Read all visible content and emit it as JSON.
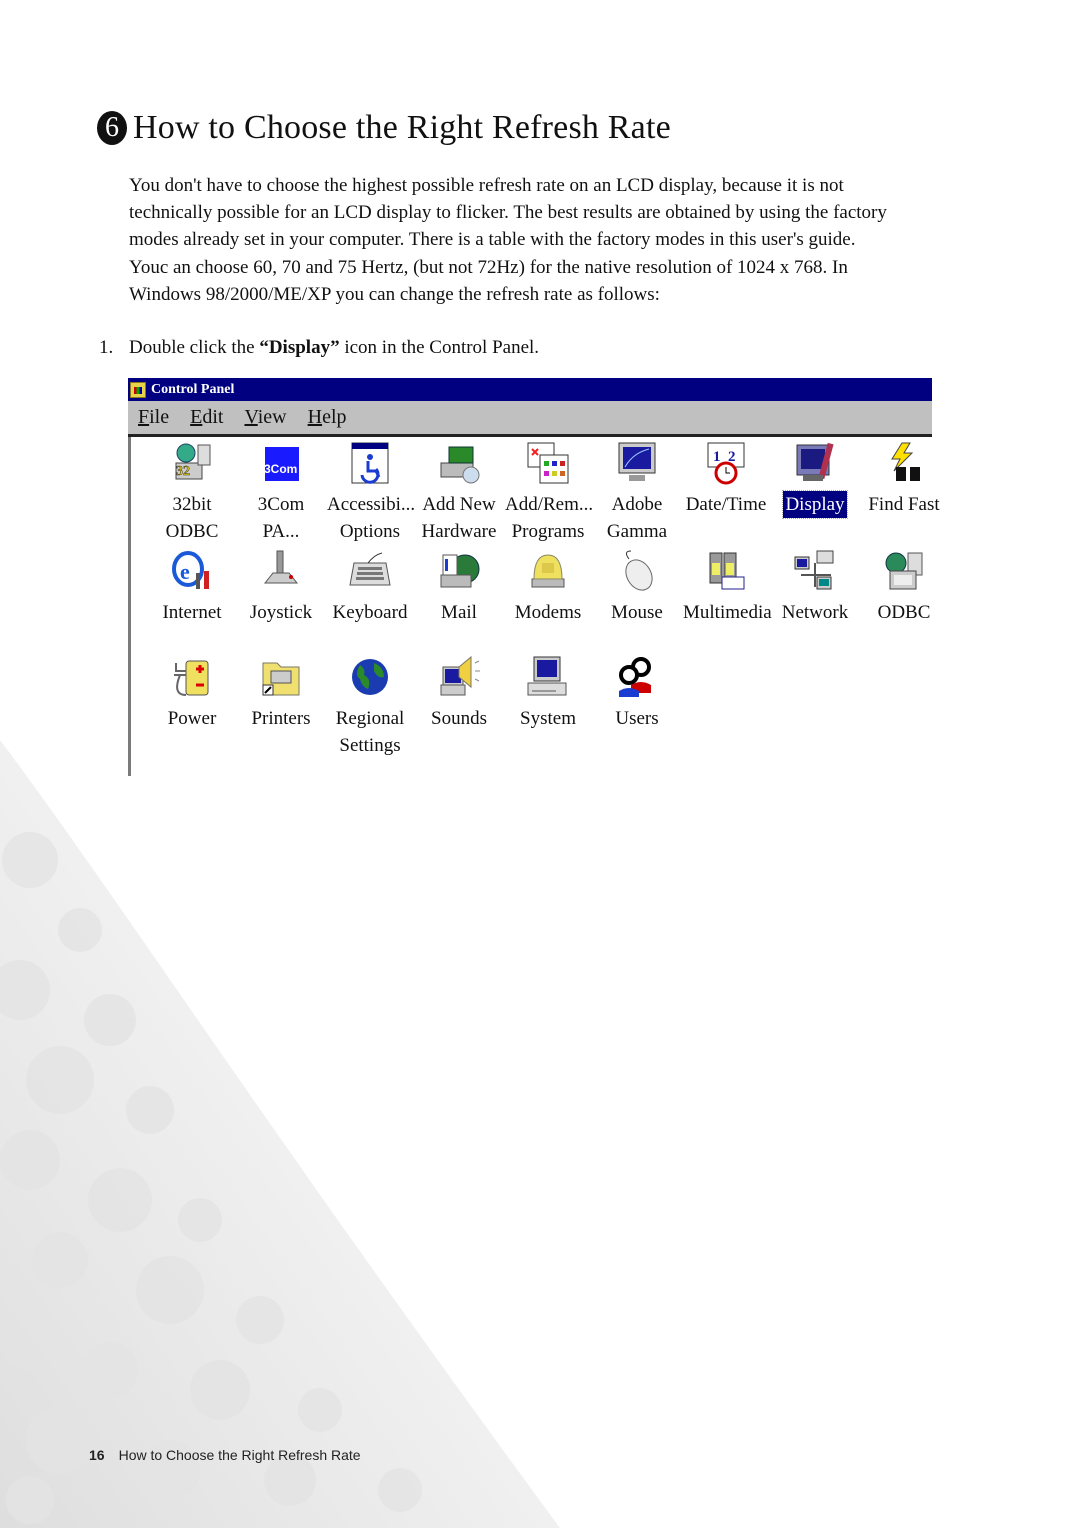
{
  "heading": {
    "number": "6",
    "title": "How to Choose the Right Refresh Rate"
  },
  "intro_lines": [
    "You don't  have to choose the highest possible refresh rate on an LCD display, because it is not",
    "technically possible for an LCD display to flicker. The best results are obtained by using the factory",
    "modes already set in your computer. There is a table with the factory modes in this user's guide.",
    "Youc an choose 60, 70 and 75 Hertz, (but not 72Hz) for the native resolution of 1024 x 768. In",
    "Windows 98/2000/ME/XP you can change the refresh rate as follows:"
  ],
  "steps": [
    {
      "number": "1.",
      "before": "Double click the ",
      "bold": "“Display”",
      "after": " icon in the Control Panel."
    }
  ],
  "control_panel": {
    "title": "Control Panel",
    "title_icon": "control-panel-icon",
    "menu": [
      {
        "mnemonic": "F",
        "rest": "ile"
      },
      {
        "mnemonic": "E",
        "rest": "dit"
      },
      {
        "mnemonic": "V",
        "rest": "iew"
      },
      {
        "mnemonic": "H",
        "rest": "elp"
      }
    ],
    "colors": {
      "titlebar": "#000080",
      "menubar": "#c0c0c0",
      "selection": "#000080"
    },
    "items": [
      {
        "line1": "32bit",
        "line2": "ODBC",
        "icon": "odbc-32bit-icon",
        "selected": false
      },
      {
        "line1": "3Com",
        "line2": "PA...",
        "icon": "3com-icon",
        "selected": false
      },
      {
        "line1": "Accessibi...",
        "line2": "Options",
        "icon": "accessibility-icon",
        "selected": false
      },
      {
        "line1": "Add New",
        "line2": "Hardware",
        "icon": "add-hardware-icon",
        "selected": false
      },
      {
        "line1": "Add/Rem...",
        "line2": "Programs",
        "icon": "add-remove-programs-icon",
        "selected": false
      },
      {
        "line1": "Adobe",
        "line2": "Gamma",
        "icon": "adobe-gamma-icon",
        "selected": false
      },
      {
        "line1": "Date/Time",
        "line2": "",
        "icon": "date-time-icon",
        "selected": false
      },
      {
        "line1": "Display",
        "line2": "",
        "icon": "display-icon",
        "selected": true
      },
      {
        "line1": "Find Fast",
        "line2": "",
        "icon": "find-fast-icon",
        "selected": false
      },
      {
        "line1": "Internet",
        "line2": "",
        "icon": "internet-icon",
        "selected": false
      },
      {
        "line1": "Joystick",
        "line2": "",
        "icon": "joystick-icon",
        "selected": false
      },
      {
        "line1": "Keyboard",
        "line2": "",
        "icon": "keyboard-icon",
        "selected": false
      },
      {
        "line1": "Mail",
        "line2": "",
        "icon": "mail-icon",
        "selected": false
      },
      {
        "line1": "Modems",
        "line2": "",
        "icon": "modems-icon",
        "selected": false
      },
      {
        "line1": "Mouse",
        "line2": "",
        "icon": "mouse-icon",
        "selected": false
      },
      {
        "line1": "Multimedia",
        "line2": "",
        "icon": "multimedia-icon",
        "selected": false
      },
      {
        "line1": "Network",
        "line2": "",
        "icon": "network-icon",
        "selected": false
      },
      {
        "line1": "ODBC",
        "line2": "",
        "icon": "odbc-icon",
        "selected": false
      },
      {
        "line1": "Power",
        "line2": "",
        "icon": "power-icon",
        "selected": false
      },
      {
        "line1": "Printers",
        "line2": "",
        "icon": "printers-icon",
        "selected": false
      },
      {
        "line1": "Regional",
        "line2": "Settings",
        "icon": "regional-settings-icon",
        "selected": false
      },
      {
        "line1": "Sounds",
        "line2": "",
        "icon": "sounds-icon",
        "selected": false
      },
      {
        "line1": "System",
        "line2": "",
        "icon": "system-icon",
        "selected": false
      },
      {
        "line1": "Users",
        "line2": "",
        "icon": "users-icon",
        "selected": false
      }
    ]
  },
  "footer": {
    "page_number": "16",
    "section": "How to Choose the Right Refresh Rate"
  }
}
